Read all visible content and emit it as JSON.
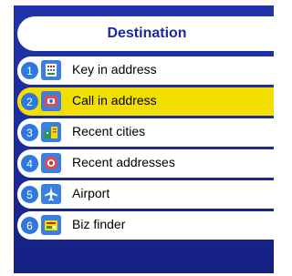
{
  "header": {
    "title": "Destination"
  },
  "menu": {
    "items": [
      {
        "number": "1",
        "label": "Key in address",
        "icon": "keypad-icon",
        "selected": false
      },
      {
        "number": "2",
        "label": "Call in address",
        "icon": "phone-icon",
        "selected": true
      },
      {
        "number": "3",
        "label": "Recent cities",
        "icon": "city-icon",
        "selected": false
      },
      {
        "number": "4",
        "label": "Recent addresses",
        "icon": "location-pin-icon",
        "selected": false
      },
      {
        "number": "5",
        "label": "Airport",
        "icon": "airplane-icon",
        "selected": false
      },
      {
        "number": "6",
        "label": "Biz finder",
        "icon": "business-icon",
        "selected": false
      }
    ]
  },
  "colors": {
    "background": "#1a2a99",
    "selected": "#f2df00",
    "badge": "#2f78e0",
    "title_text": "#1a2a99"
  }
}
